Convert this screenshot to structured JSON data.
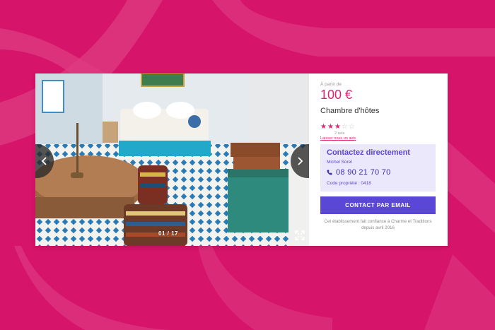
{
  "gallery": {
    "counter": "01 / 17",
    "current_index": 1,
    "total_images": 17
  },
  "listing": {
    "from_label": "À partir de",
    "price": "100 €",
    "title": "Chambre d'hôtes",
    "rating": 3,
    "rating_max": 5,
    "review_count": "2 avis",
    "review_link": "Laisser nous un avis"
  },
  "contact": {
    "heading": "Contactez directement",
    "name": "Michel Sorel",
    "phone": "08 90 21 70 70",
    "property_code": "Code propriété : 0418",
    "email_button": "CONTACT PAR EMAIL"
  },
  "trust_note": "Cet établissement fait confiance à Charme et Traditions depuis avril 2016",
  "icons": {
    "prev": "chevron-left-icon",
    "next": "chevron-right-icon",
    "expand": "fullscreen-icon",
    "phone": "phone-icon",
    "star": "star-icon"
  },
  "colors": {
    "background": "#d61469",
    "accent_pink": "#e0246f",
    "accent_purple": "#5b47d6",
    "contact_bg": "#ebe8fb"
  }
}
